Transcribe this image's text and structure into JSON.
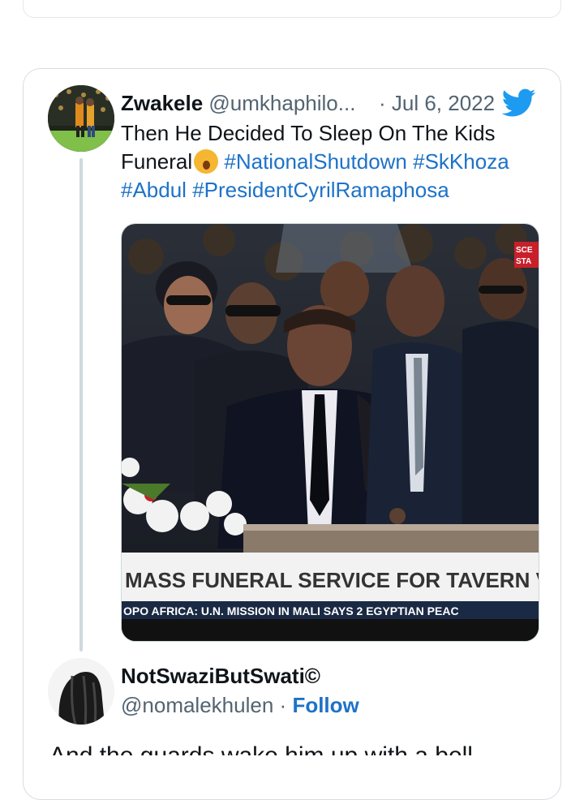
{
  "tweet": {
    "display_name": "Zwakele",
    "handle": "@umkhaphilo...",
    "date": "· Jul 6, 2022",
    "text_part1": "Then He Decided To Sleep On The Kids Funeral",
    "hashtags": [
      "#NationalShutdown",
      "#SkKhoza",
      "#Abdul",
      "#PresidentCyrilRamaphosa"
    ],
    "media": {
      "tv_corner": [
        "SCE",
        "STA"
      ],
      "headline": "MASS FUNERAL SERVICE FOR TAVERN VIC",
      "ticker": "OPO  AFRICA: U.N. MISSION IN MALI SAYS 2 EGYPTIAN PEAC"
    }
  },
  "reply": {
    "display_name": "NotSwaziButSwati©",
    "handle": "@nomalekhulen",
    "separator": "·",
    "follow_label": "Follow",
    "text_partial": "And the guards wake him up with a bell"
  },
  "colors": {
    "link_blue": "#1d72c8",
    "twitter_blue": "#1d9bf0",
    "secondary_text": "#536471",
    "border": "#d6dde3"
  },
  "icons": [
    "twitter-bird-icon"
  ]
}
